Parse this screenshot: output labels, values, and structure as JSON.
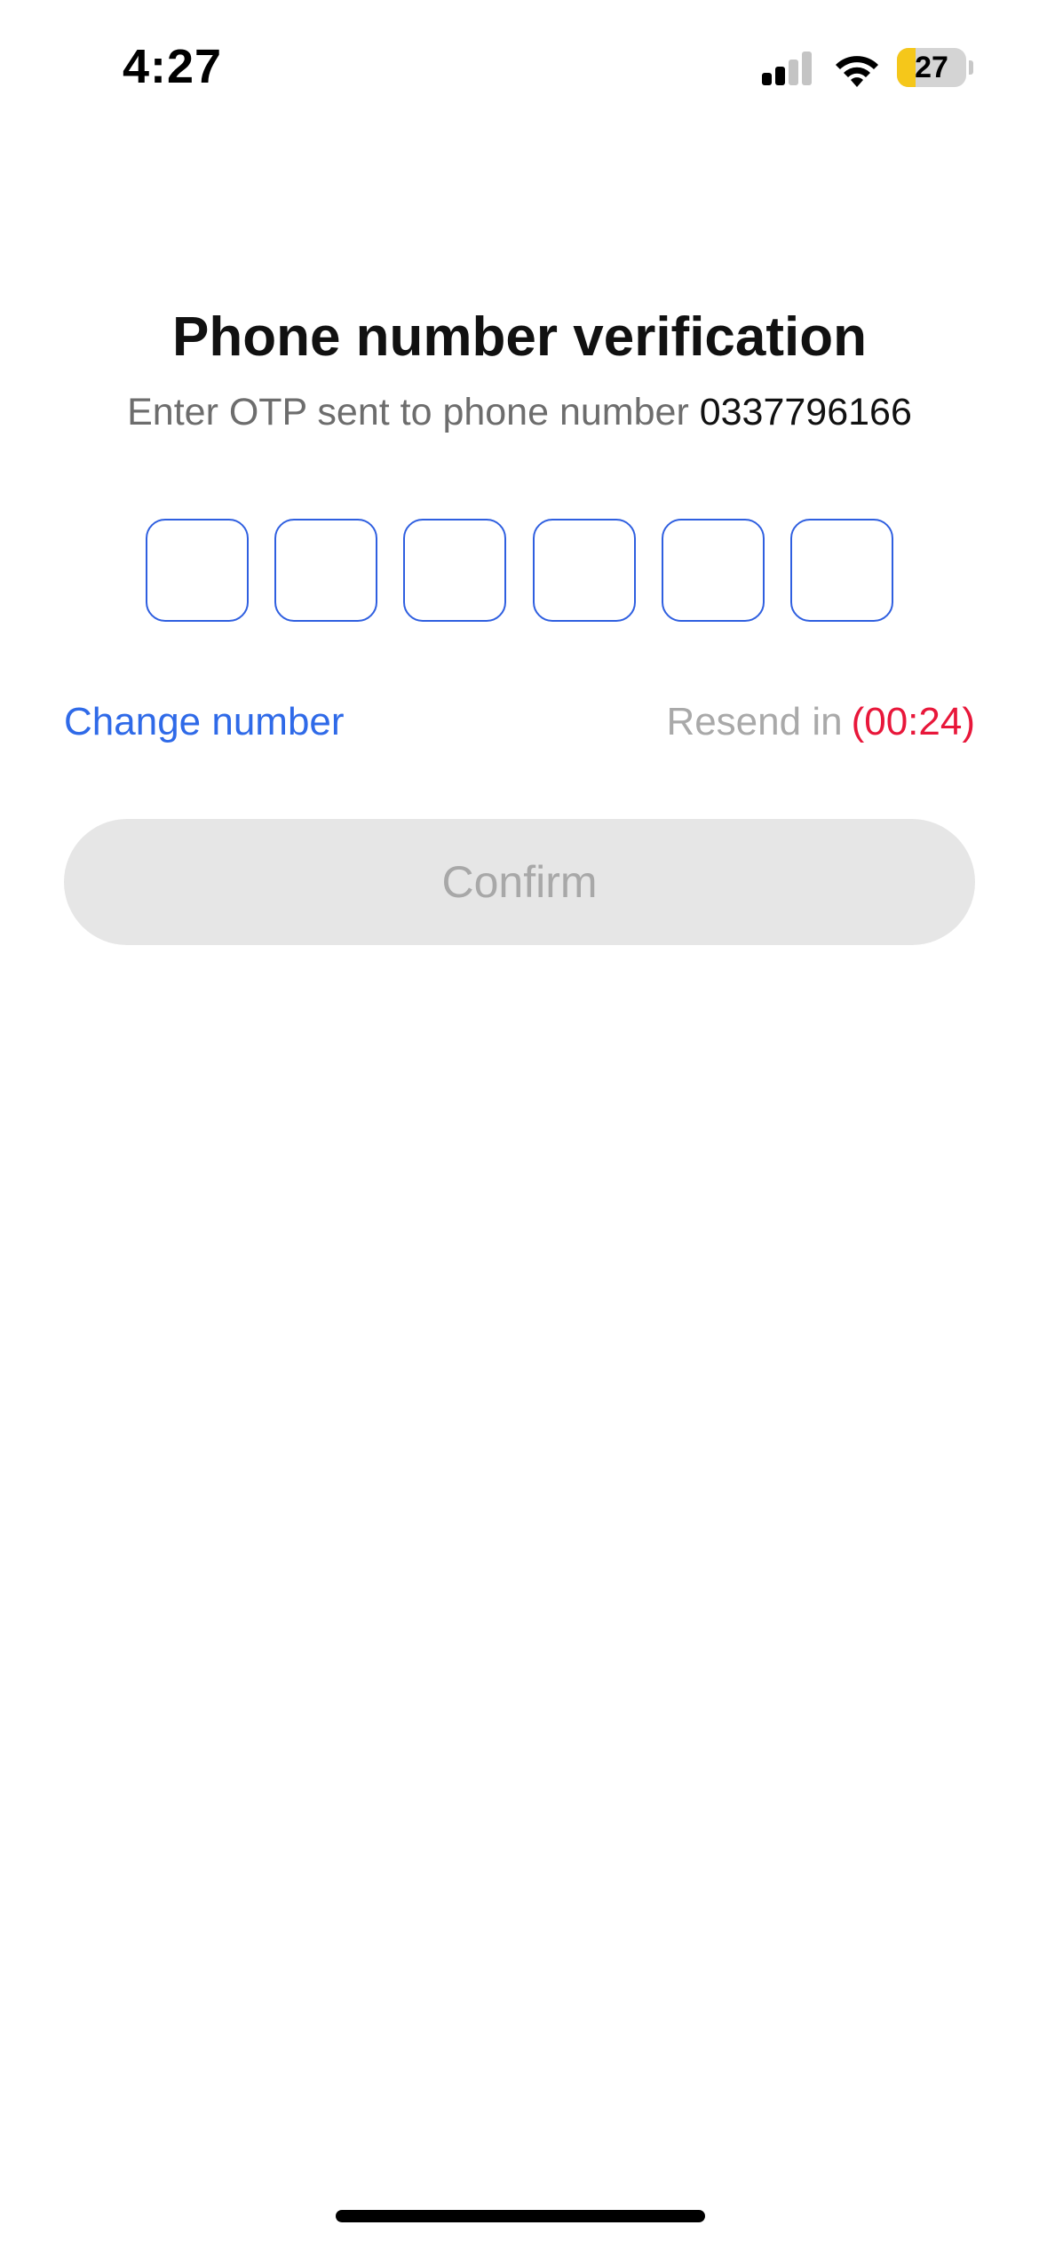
{
  "status_bar": {
    "time": "4:27",
    "battery_level": "27",
    "battery_fraction": 0.27,
    "signal_icon": "cellular-signal-icon",
    "wifi_icon": "wifi-icon",
    "battery_icon": "battery-icon"
  },
  "verification": {
    "title": "Phone number verification",
    "subtitle_prefix": "Enter OTP sent to phone number",
    "phone_number": "0337796166",
    "otp_digits": [
      "",
      "",
      "",
      "",
      "",
      ""
    ]
  },
  "actions": {
    "change_number_label": "Change number",
    "resend_label": "Resend in",
    "resend_timer": "(00:24)",
    "confirm_label": "Confirm"
  },
  "colors": {
    "accent_blue": "#2f6ae8",
    "otp_border": "#2f5fe0",
    "timer_red": "#e8173a",
    "disabled_button_bg": "#e6e6e6",
    "disabled_button_text": "#a8a8a8",
    "battery_low_yellow": "#f5c71a"
  }
}
